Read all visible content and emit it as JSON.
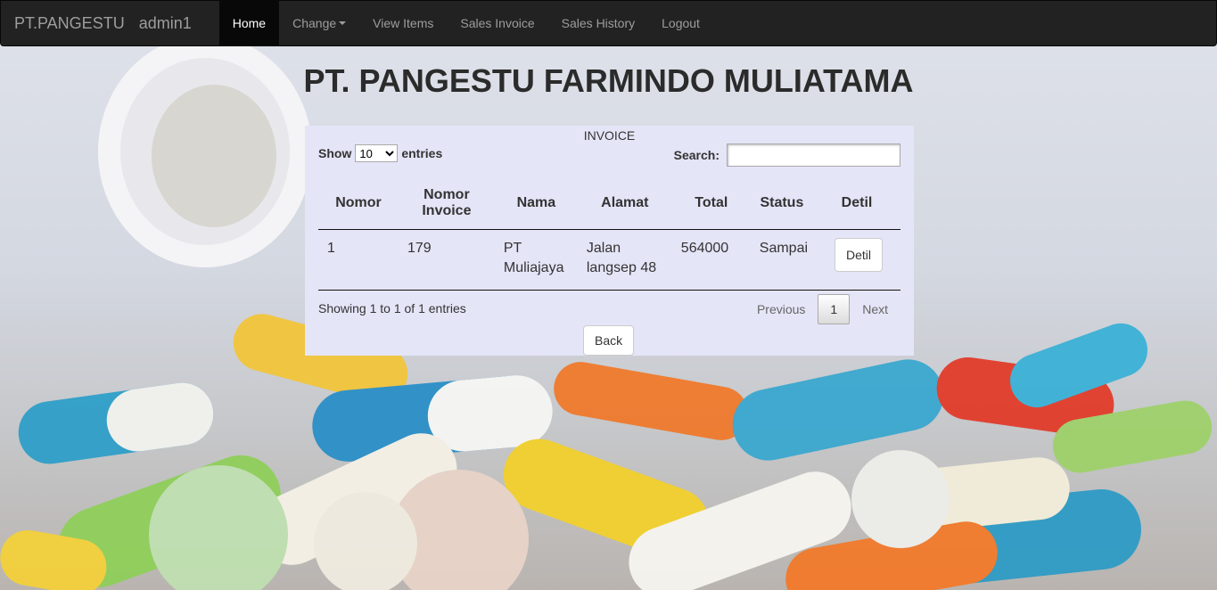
{
  "navbar": {
    "brand": "PT.PANGESTU",
    "user": "admin1",
    "items": [
      {
        "label": "Home",
        "active": true
      },
      {
        "label": "Change",
        "dropdown": true
      },
      {
        "label": "View Items"
      },
      {
        "label": "Sales Invoice"
      },
      {
        "label": "Sales History"
      },
      {
        "label": "Logout"
      }
    ]
  },
  "page_title": "PT. PANGESTU FARMINDO MULIATAMA",
  "panel": {
    "caption": "INVOICE",
    "length": {
      "show_label": "Show",
      "value": "10",
      "entries_label": "entries"
    },
    "search": {
      "label": "Search:",
      "value": ""
    },
    "columns": [
      "Nomor",
      "Nomor Invoice",
      "Nama",
      "Alamat",
      "Total",
      "Status",
      "Detil"
    ],
    "rows": [
      {
        "nomor": "1",
        "nomor_invoice": "179",
        "nama": "PT Muliajaya",
        "alamat": "Jalan langsep 48",
        "total": "564000",
        "status": "Sampai",
        "detil_label": "Detil"
      }
    ],
    "info": "Showing 1 to 1 of 1 entries",
    "pagination": {
      "previous": "Previous",
      "current": "1",
      "next": "Next"
    },
    "back_label": "Back"
  },
  "colors": {
    "navbar": "#222222",
    "panel": "#e5e5f8",
    "active_nav": "#080808"
  }
}
